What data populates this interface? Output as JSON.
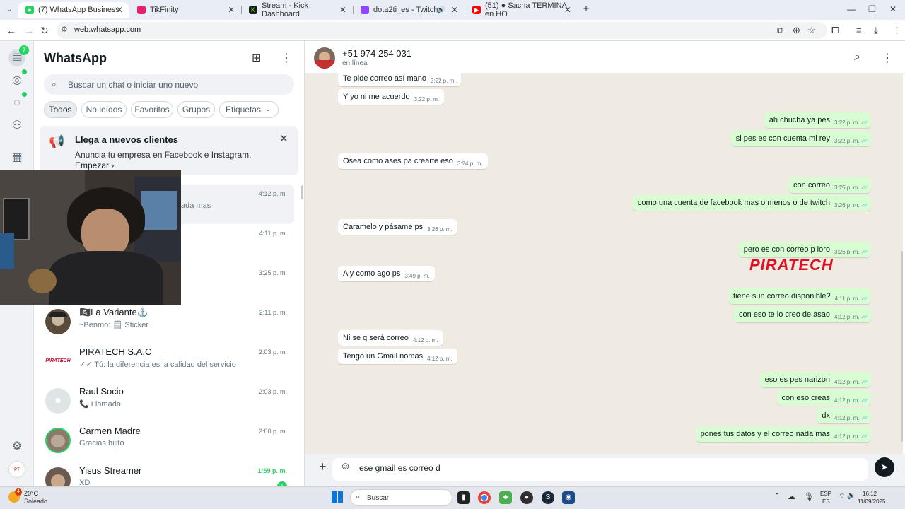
{
  "browser": {
    "tabs": [
      {
        "label": "(7) WhatsApp Business",
        "color": "#25d366"
      },
      {
        "label": "TikFinity",
        "color": "#e3226b"
      },
      {
        "label": "Stream - Kick Dashboard",
        "color": "#53fc18"
      },
      {
        "label": "dota2ti_es - Twitch",
        "color": "#9146ff"
      },
      {
        "label": "(51) ● Sacha TERMINA en HO",
        "color": "#ff0000"
      }
    ],
    "url": "web.whatsapp.com"
  },
  "sidebar": {
    "title": "WhatsApp",
    "unread_badge": "7",
    "search_placeholder": "Buscar un chat o iniciar uno nuevo",
    "filters": [
      "Todos",
      "No leídos",
      "Favoritos",
      "Grupos",
      "Etiquetas"
    ],
    "promo": {
      "title": "Llega a nuevos clientes",
      "subtitle": "Anuncia tu empresa en Facebook e Instagram.",
      "link": "Empezar ›"
    },
    "chats": [
      {
        "name": "",
        "preview": "ada mas",
        "time": "4:12 p. m."
      },
      {
        "name": "",
        "preview": "",
        "time": "4:11 p. m."
      },
      {
        "name": "",
        "preview": "",
        "time": "3:25 p. m."
      },
      {
        "name": "🏴‍☠️La Variante⚓",
        "preview": "~Benmo: 🗒 Sticker",
        "time": "2:11 p. m."
      },
      {
        "name": "PIRATECH S.A.C",
        "preview": "✓✓ Tú: la diferencia es la calidad del servicio",
        "time": "2:03 p. m."
      },
      {
        "name": "Raul Socio",
        "preview": "📞 Llamada",
        "time": "2:03 p. m."
      },
      {
        "name": "Carmen Madre",
        "preview": "Gracias hijito",
        "time": "2:00 p. m."
      },
      {
        "name": "Yisus Streamer",
        "preview": "XD",
        "time": "1:59 p. m.",
        "unread": "1"
      }
    ]
  },
  "chat": {
    "contact": "+51 974 254 031",
    "status": "en línea",
    "messages": [
      {
        "dir": "in",
        "text": "Te pide correo así mano",
        "time": "3:22 p. m."
      },
      {
        "dir": "in",
        "text": "Y yo ni me acuerdo",
        "time": "3:22 p. m."
      },
      {
        "dir": "out",
        "text": "ah chucha ya pes",
        "time": "3:22 p. m."
      },
      {
        "dir": "out",
        "text": "si pes es con cuenta mi rey",
        "time": "3:22 p. m."
      },
      {
        "dir": "in",
        "text": "Osea como ases pa crearte eso",
        "time": "3:24 p. m."
      },
      {
        "dir": "out",
        "text": "con correo",
        "time": "3:25 p. m."
      },
      {
        "dir": "out",
        "text": "como una cuenta de facebook mas o menos o de twitch",
        "time": "3:26 p. m."
      },
      {
        "dir": "in",
        "text": "Caramelo y pásame ps",
        "time": "3:26 p. m."
      },
      {
        "dir": "out",
        "text": "pero es con correo p loro",
        "time": "3:26 p. m."
      },
      {
        "dir": "in",
        "text": "A y como ago ps",
        "time": "3:49 p. m."
      },
      {
        "dir": "out",
        "text": "tiene sun correo disponible?",
        "time": "4:11 p. m."
      },
      {
        "dir": "out",
        "text": "con eso te lo creo de asao",
        "time": "4:12 p. m."
      },
      {
        "dir": "in",
        "text": "Ni se q será correo",
        "time": "4:12 p. m."
      },
      {
        "dir": "in",
        "text": "Tengo un Gmail nomas",
        "time": "4:12 p. m."
      },
      {
        "dir": "out",
        "text": "eso es pes narizon",
        "time": "4:12 p. m."
      },
      {
        "dir": "out",
        "text": "con eso creas",
        "time": "4:12 p. m."
      },
      {
        "dir": "out",
        "text": "dx",
        "time": "4:12 p. m."
      },
      {
        "dir": "out",
        "text": "pones tus datos y el correo nada mas",
        "time": "4:12 p. m."
      }
    ],
    "composer_text": "ese gmail es correo d",
    "watermark": "PIRATECH"
  },
  "taskbar": {
    "weather_temp": "20°C",
    "weather_desc": "Soleado",
    "weather_badge": "4",
    "search": "Buscar",
    "lang": "ESP",
    "lang_sub": "ES",
    "time": "16:12",
    "date": "11/09/2025"
  },
  "colors": {
    "accent": "#25d366",
    "outgoing_bubble": "#d9fdd3",
    "chat_bg": "#efeae2",
    "read_ticks": "#53bdeb"
  }
}
